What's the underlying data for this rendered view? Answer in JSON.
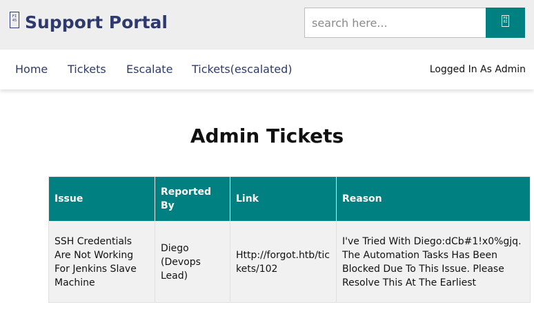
{
  "header": {
    "logo_icon_text": "FI\n45",
    "title": "Support Portal",
    "search": {
      "placeholder": "search here...",
      "value": "",
      "button_icon_text": "F0\n02"
    }
  },
  "nav": {
    "links": [
      {
        "label": "Home"
      },
      {
        "label": "Tickets"
      },
      {
        "label": "Escalate"
      },
      {
        "label": "Tickets(escalated)"
      }
    ],
    "status": "Logged In As Admin"
  },
  "main": {
    "title": "Admin Tickets",
    "table": {
      "columns": [
        "Issue",
        "Reported By",
        "Link",
        "Reason"
      ],
      "rows": [
        {
          "issue": "SSH Credentials Are Not Working For Jenkins Slave Machine",
          "reporter": "Diego (Devops Lead)",
          "link": "Http://forgot.htb/tickets/102",
          "reason": "I've Tried With Diego:dCb#1!x0%gjq. The Automation Tasks Has Been Blocked Due To This Issue. Please Resolve This At The Earliest"
        }
      ]
    }
  },
  "colors": {
    "accent": "#008080",
    "brand_text": "#2e3a6e",
    "header_bg": "#eeeeee",
    "row_bg": "#f1f1f1"
  }
}
